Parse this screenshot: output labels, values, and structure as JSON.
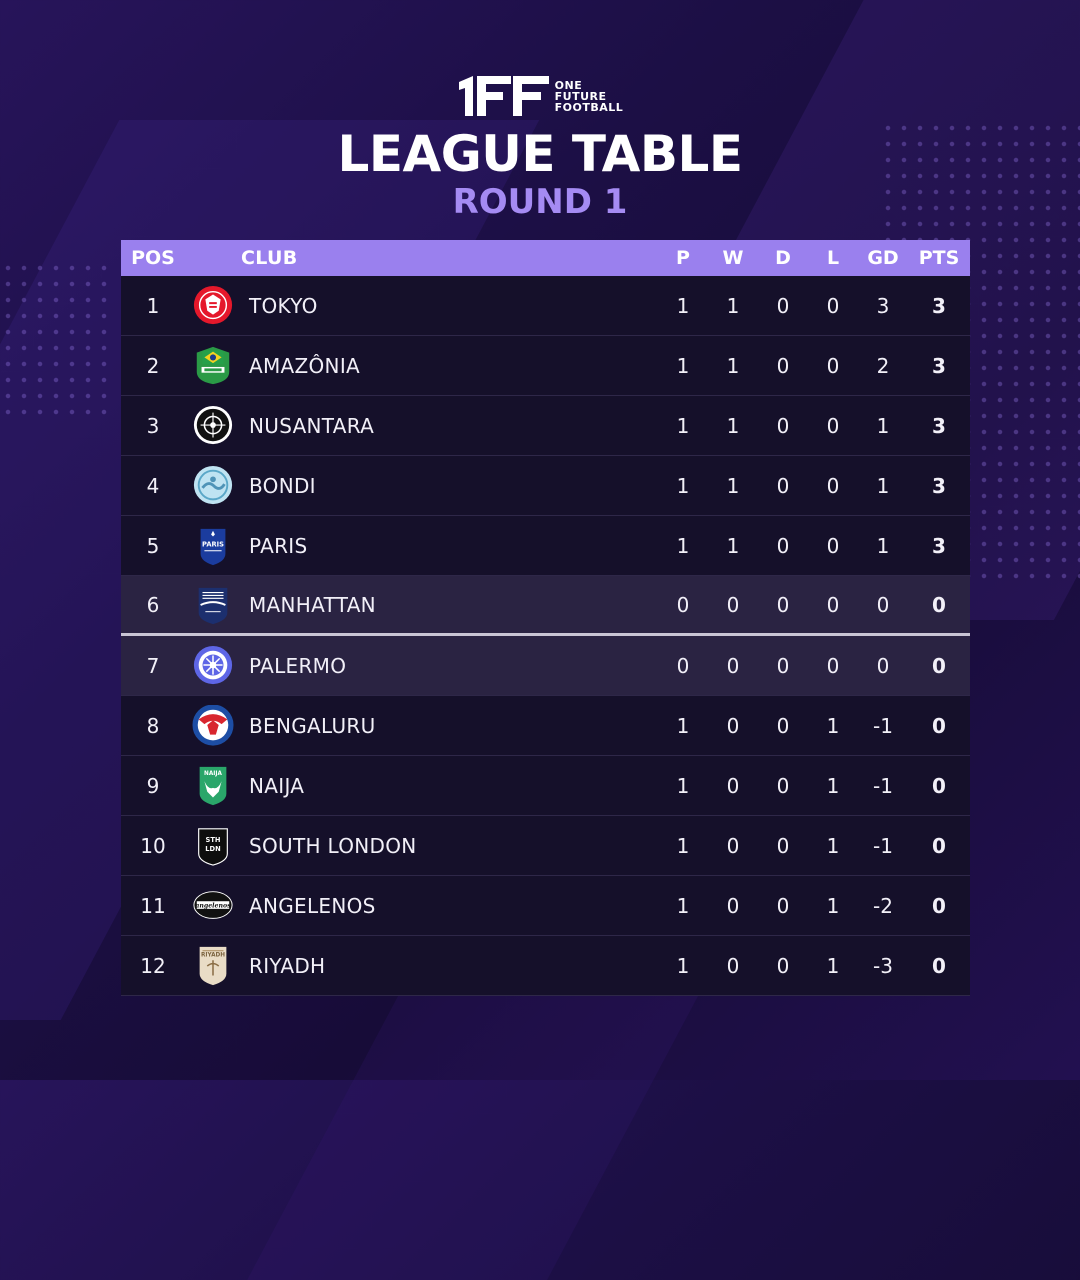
{
  "brand": {
    "mark": "1FF",
    "lines": [
      "ONE",
      "FUTURE",
      "FOOTBALL"
    ]
  },
  "title": "LEAGUE TABLE",
  "subtitle": "ROUND 1",
  "colors": {
    "accent": "#9a80ee",
    "subtitle": "#a58bf3",
    "row": "#15102a",
    "row_highlight": "#2a2342"
  },
  "table": {
    "headers": {
      "pos": "POS",
      "club": "CLUB",
      "p": "P",
      "w": "W",
      "d": "D",
      "l": "L",
      "gd": "GD",
      "pts": "PTS"
    },
    "rows": [
      {
        "pos": "1",
        "club": "TOKYO",
        "badge": "tokyo-crest-icon",
        "p": "1",
        "w": "1",
        "d": "0",
        "l": "0",
        "gd": "3",
        "pts": "3"
      },
      {
        "pos": "2",
        "club": "AMAZÔNIA",
        "badge": "amazonia-crest-icon",
        "p": "1",
        "w": "1",
        "d": "0",
        "l": "0",
        "gd": "2",
        "pts": "3"
      },
      {
        "pos": "3",
        "club": "NUSANTARA",
        "badge": "nusantara-crest-icon",
        "p": "1",
        "w": "1",
        "d": "0",
        "l": "0",
        "gd": "1",
        "pts": "3"
      },
      {
        "pos": "4",
        "club": "BONDI",
        "badge": "bondi-crest-icon",
        "p": "1",
        "w": "1",
        "d": "0",
        "l": "0",
        "gd": "1",
        "pts": "3"
      },
      {
        "pos": "5",
        "club": "PARIS",
        "badge": "paris-crest-icon",
        "p": "1",
        "w": "1",
        "d": "0",
        "l": "0",
        "gd": "1",
        "pts": "3"
      },
      {
        "pos": "6",
        "club": "MANHATTAN",
        "badge": "manhattan-crest-icon",
        "p": "0",
        "w": "0",
        "d": "0",
        "l": "0",
        "gd": "0",
        "pts": "0"
      },
      {
        "pos": "7",
        "club": "PALERMO",
        "badge": "palermo-crest-icon",
        "p": "0",
        "w": "0",
        "d": "0",
        "l": "0",
        "gd": "0",
        "pts": "0"
      },
      {
        "pos": "8",
        "club": "BENGALURU",
        "badge": "bengaluru-crest-icon",
        "p": "1",
        "w": "0",
        "d": "0",
        "l": "1",
        "gd": "-1",
        "pts": "0"
      },
      {
        "pos": "9",
        "club": "NAIJA",
        "badge": "naija-crest-icon",
        "p": "1",
        "w": "0",
        "d": "0",
        "l": "1",
        "gd": "-1",
        "pts": "0"
      },
      {
        "pos": "10",
        "club": "SOUTH LONDON",
        "badge": "south-london-crest-icon",
        "p": "1",
        "w": "0",
        "d": "0",
        "l": "1",
        "gd": "-1",
        "pts": "0"
      },
      {
        "pos": "11",
        "club": "ANGELENOS",
        "badge": "angelenos-crest-icon",
        "p": "1",
        "w": "0",
        "d": "0",
        "l": "1",
        "gd": "-2",
        "pts": "0"
      },
      {
        "pos": "12",
        "club": "RIYADH",
        "badge": "riyadh-crest-icon",
        "p": "1",
        "w": "0",
        "d": "0",
        "l": "1",
        "gd": "-3",
        "pts": "0"
      }
    ]
  }
}
